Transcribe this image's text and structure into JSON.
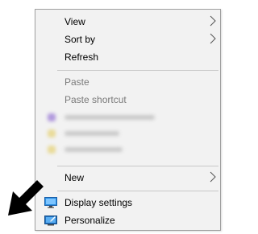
{
  "context_menu": {
    "items": [
      {
        "label": "View",
        "submenu": true,
        "enabled": true
      },
      {
        "label": "Sort by",
        "submenu": true,
        "enabled": true
      },
      {
        "label": "Refresh",
        "submenu": false,
        "enabled": true
      }
    ],
    "edit_items": [
      {
        "label": "Paste",
        "enabled": false
      },
      {
        "label": "Paste shortcut",
        "enabled": false
      }
    ],
    "new_item": {
      "label": "New",
      "submenu": true
    },
    "display_settings": {
      "label": "Display settings",
      "icon": "monitor-icon"
    },
    "personalize": {
      "label": "Personalize",
      "icon": "personalize-icon"
    }
  },
  "blurred_items": [
    {
      "icon_color": "#9b7bd6"
    },
    {
      "icon_color": "#e6d37a"
    },
    {
      "icon_color": "#e6d37a"
    }
  ],
  "annotation": {
    "icon": "black-arrow-pointer",
    "color": "#000000"
  },
  "colors": {
    "menu_bg": "#f2f2f2",
    "menu_border": "#a0a0a0",
    "disabled_text": "#7a7a7a",
    "accent": "#1e78d6"
  }
}
